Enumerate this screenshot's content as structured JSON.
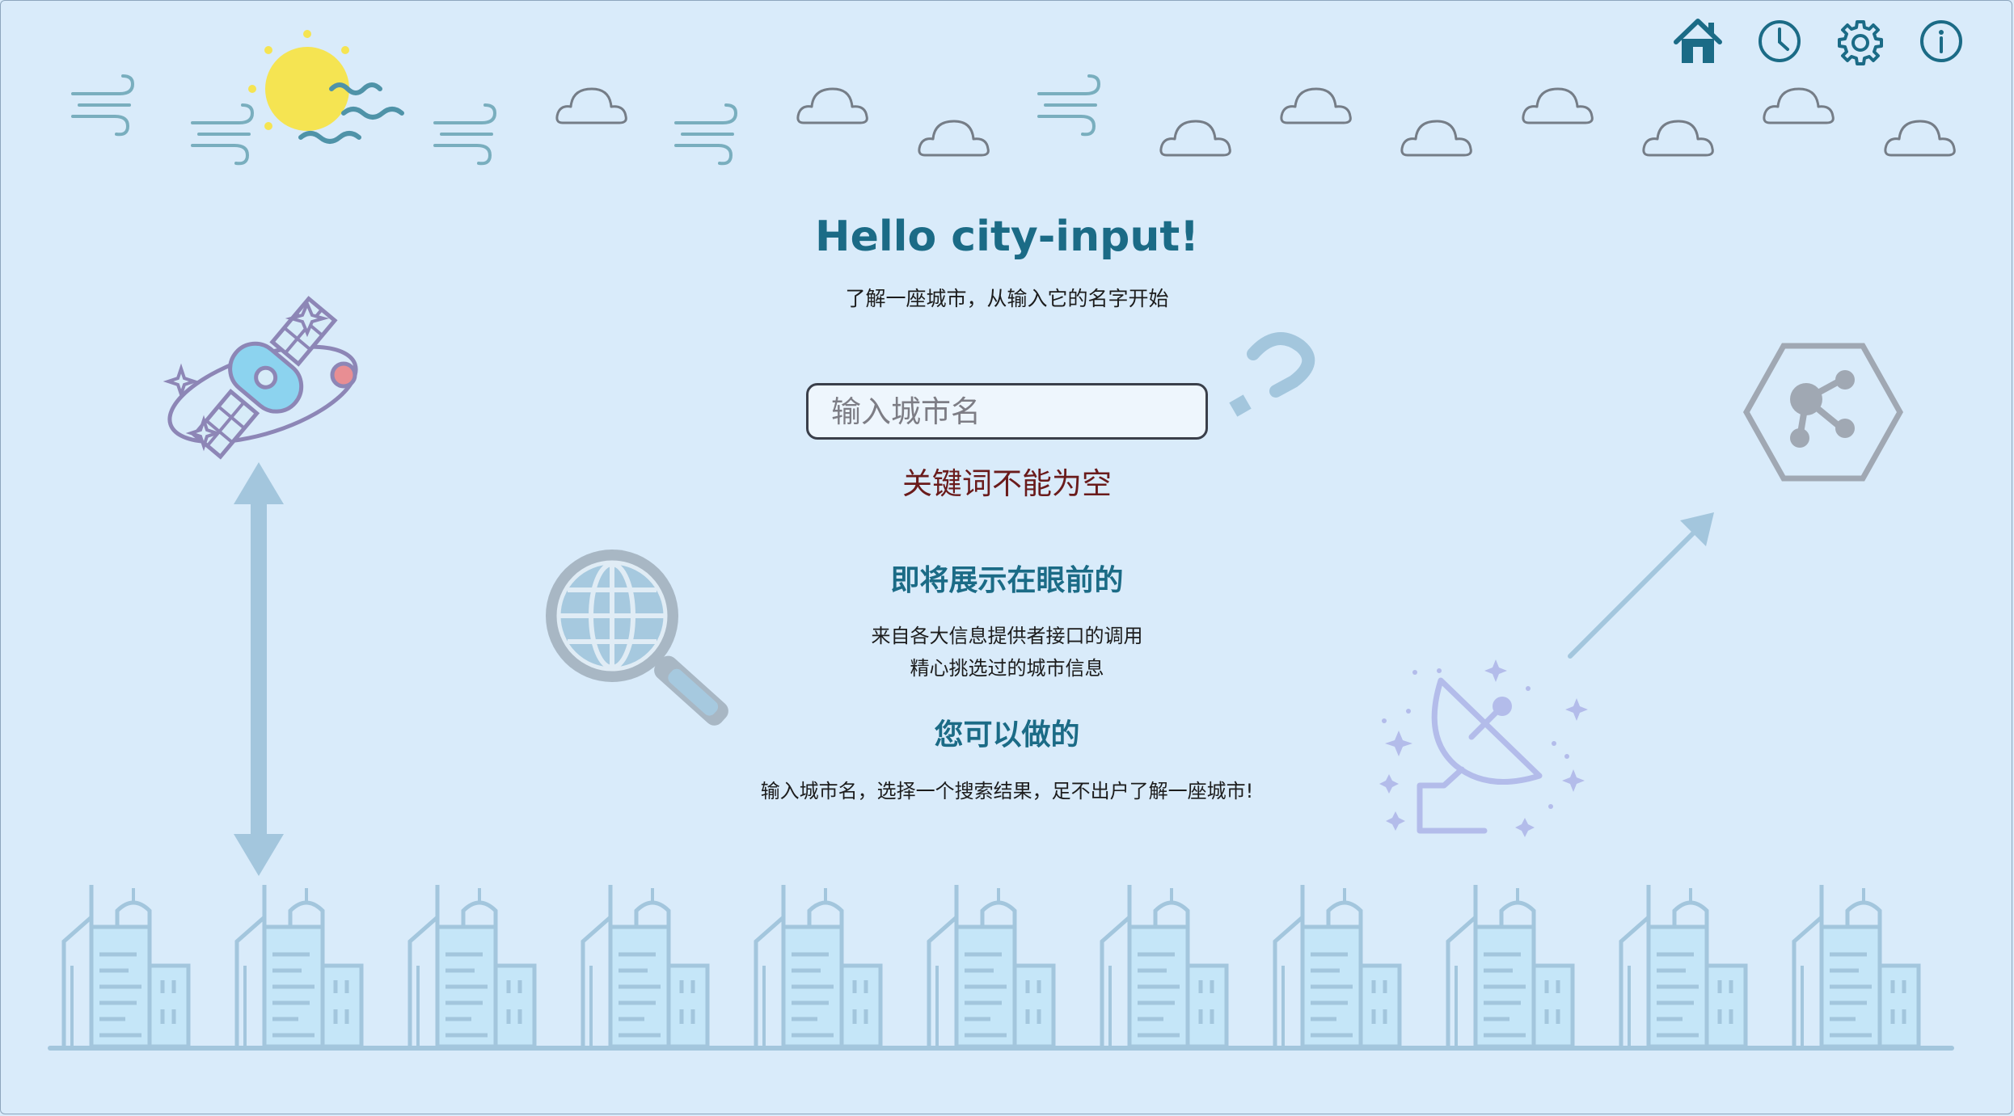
{
  "nav": {
    "icons": [
      "home-icon",
      "clock-icon",
      "gear-icon",
      "info-icon"
    ]
  },
  "hero": {
    "title": "Hello city-input!",
    "subtitle": "了解一座城市，从输入它的名字开始"
  },
  "search": {
    "placeholder": "输入城市名",
    "value": "",
    "error": "关键词不能为空"
  },
  "features": {
    "title": "即将展示在眼前的",
    "lines": [
      "来自各大信息提供者接口的调用",
      "精心挑选过的城市信息"
    ]
  },
  "actions": {
    "title": "您可以做的",
    "text": "输入城市名，选择一个搜索结果，足不出户了解一座城市!"
  },
  "colors": {
    "background": "#d9ebfa",
    "accent": "#1b6b86",
    "error": "#6a1b1b",
    "decor": "#a3c6dd",
    "sun": "#f5e452"
  }
}
